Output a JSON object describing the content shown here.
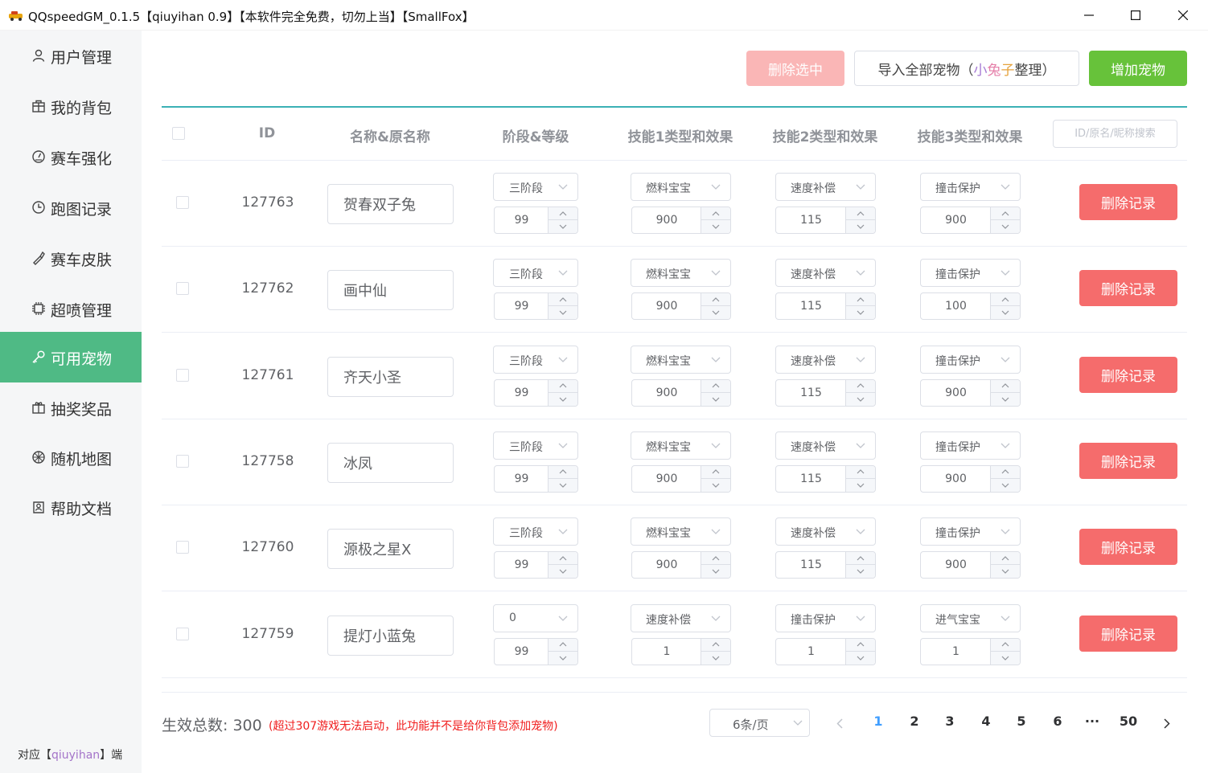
{
  "window": {
    "title": "QQspeedGM_0.1.5【qiuyihan 0.9】【本软件完全免费，切勿上当】【SmallFox】"
  },
  "sidebar": {
    "items": [
      {
        "label": "用户管理",
        "icon": "user-icon"
      },
      {
        "label": "我的背包",
        "icon": "backpack-icon"
      },
      {
        "label": "赛车强化",
        "icon": "gauge-icon"
      },
      {
        "label": "跑图记录",
        "icon": "clock-icon"
      },
      {
        "label": "赛车皮肤",
        "icon": "brush-icon"
      },
      {
        "label": "超喷管理",
        "icon": "chip-icon"
      },
      {
        "label": "可用宠物",
        "icon": "key-icon"
      },
      {
        "label": "抽奖奖品",
        "icon": "gift-icon"
      },
      {
        "label": "随机地图",
        "icon": "globe-icon"
      },
      {
        "label": "帮助文档",
        "icon": "doc-icon"
      }
    ],
    "active_index": 6,
    "footer_prefix": "对应【",
    "footer_highlight": "qiuyihan",
    "footer_suffix": "】端"
  },
  "toolbar": {
    "delete_selected": "删除选中",
    "import_prefix": "导入全部宠物（",
    "import_c1": "小",
    "import_c2": "兔",
    "import_c3": "子",
    "import_suffix": "整理）",
    "add_pet": "增加宠物"
  },
  "table": {
    "headers": {
      "id": "ID",
      "name": "名称&原名称",
      "stage": "阶段&等级",
      "skill1": "技能1类型和效果",
      "skill2": "技能2类型和效果",
      "skill3": "技能3类型和效果"
    },
    "search_placeholder": "ID/原名/昵称搜索",
    "delete_label": "删除记录",
    "rows": [
      {
        "id": "127763",
        "name": "贺春双子兔",
        "stage": "三阶段",
        "level": "99",
        "s1": "燃料宝宝",
        "v1": "900",
        "s2": "速度补偿",
        "v2": "115",
        "s3": "撞击保护",
        "v3": "900"
      },
      {
        "id": "127762",
        "name": "画中仙",
        "stage": "三阶段",
        "level": "99",
        "s1": "燃料宝宝",
        "v1": "900",
        "s2": "速度补偿",
        "v2": "115",
        "s3": "撞击保护",
        "v3": "100"
      },
      {
        "id": "127761",
        "name": "齐天小圣",
        "stage": "三阶段",
        "level": "99",
        "s1": "燃料宝宝",
        "v1": "900",
        "s2": "速度补偿",
        "v2": "115",
        "s3": "撞击保护",
        "v3": "900"
      },
      {
        "id": "127758",
        "name": "冰凤",
        "stage": "三阶段",
        "level": "99",
        "s1": "燃料宝宝",
        "v1": "900",
        "s2": "速度补偿",
        "v2": "115",
        "s3": "撞击保护",
        "v3": "900"
      },
      {
        "id": "127760",
        "name": "源极之星X",
        "stage": "三阶段",
        "level": "99",
        "s1": "燃料宝宝",
        "v1": "900",
        "s2": "速度补偿",
        "v2": "115",
        "s3": "撞击保护",
        "v3": "900"
      },
      {
        "id": "127759",
        "name": "提灯小蓝兔",
        "stage": "0",
        "level": "99",
        "s1": "速度补偿",
        "v1": "1",
        "s2": "撞击保护",
        "v2": "1",
        "s3": "进气宝宝",
        "v3": "1"
      }
    ]
  },
  "footer": {
    "total_label": "生效总数:",
    "total_value": "300",
    "warning": "(超过307游戏无法启动，此功能并不是给你背包添加宠物)",
    "page_size": "6条/页",
    "pages": [
      "1",
      "2",
      "3",
      "4",
      "5",
      "6",
      "···",
      "50"
    ],
    "current_page": "1"
  },
  "colors": {
    "sidebar_active": "#4fba85",
    "primary_teal": "#3bb1b5",
    "danger": "#f56c6c",
    "danger_light": "#fab6b6",
    "success": "#67c23a",
    "page_active": "#409eff",
    "warning_text": "#f01d1d"
  }
}
